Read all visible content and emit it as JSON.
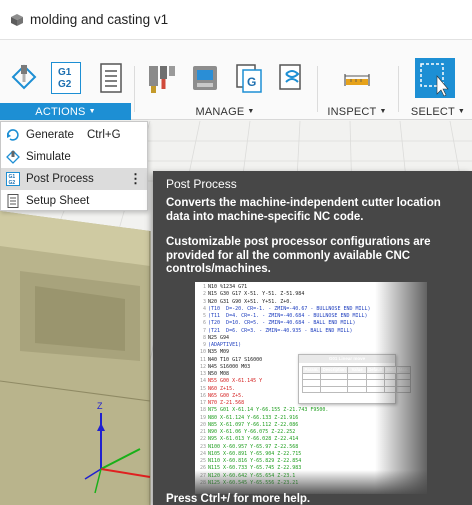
{
  "window": {
    "title": "molding and casting v1",
    "icon": "cube-icon"
  },
  "toolbar": {
    "groups": [
      {
        "label": "ACTIONS",
        "active": true
      },
      {
        "label": "MANAGE"
      },
      {
        "label": "INSPECT"
      },
      {
        "label": "SELECT"
      }
    ],
    "tools": [
      {
        "name": "simulate-tool-icon"
      },
      {
        "name": "post-process-tool",
        "text": "G1\nG2"
      },
      {
        "name": "setup-sheet-tool-icon"
      },
      {
        "name": "tool-library-icon"
      },
      {
        "name": "machine-library-icon"
      },
      {
        "name": "nc-program-icon",
        "text": "G"
      },
      {
        "name": "post-library-icon"
      },
      {
        "name": "measure-icon"
      },
      {
        "name": "window-select-icon"
      }
    ]
  },
  "menu": {
    "items": [
      {
        "label": "Generate",
        "shortcut": "Ctrl+G",
        "icon": "generate-icon"
      },
      {
        "label": "Simulate",
        "icon": "simulate-icon"
      },
      {
        "label": "Post Process",
        "icon": "post-process-icon",
        "more": "⋮",
        "active": true
      },
      {
        "label": "Setup Sheet",
        "icon": "setup-sheet-icon"
      }
    ]
  },
  "tooltip": {
    "title": "Post Process",
    "description": "Converts the machine-independent cutter location data into machine-specific NC code.",
    "detail": "Customizable post processor configurations are provided for all the commonly available CNC controls/machines.",
    "footer": "Press Ctrl+/ for more help.",
    "image": {
      "code_lines": [
        {
          "n": "1",
          "text": "N10 %1234 G71",
          "color": "#222"
        },
        {
          "n": "2",
          "text": "N15 G30 G17 X-51. Y-51. Z-51.984",
          "color": "#222"
        },
        {
          "n": "3",
          "text": "N20 G31 G90 X+51. Y+51. Z+0.",
          "color": "#222"
        },
        {
          "n": "4",
          "text": "(T10  D=-20. CR=-1. - ZMIN=-40.67 - BULLNOSE END MILL)",
          "color": "#1f3fbf"
        },
        {
          "n": "5",
          "text": "(T11  D=4. CR=-1. - ZMIN=-40.684 - BULLNOSE END MILL)",
          "color": "#1f3fbf"
        },
        {
          "n": "6",
          "text": "(T20  D=10. CR=5. - ZMIN=-40.684 - BALL END MILL)",
          "color": "#1f3fbf"
        },
        {
          "n": "7",
          "text": "(T21  D=6. CR=3. - ZMIN=-40.935 - BALL END MILL)",
          "color": "#1f3fbf"
        },
        {
          "n": "8",
          "text": "N25 G94",
          "color": "#222"
        },
        {
          "n": "9",
          "text": "(ADAPTIVE1)",
          "color": "#1f3fbf"
        },
        {
          "n": "10",
          "text": "N35 M09",
          "color": "#222"
        },
        {
          "n": "11",
          "text": "N40 T10 G17 S16000",
          "color": "#222"
        },
        {
          "n": "12",
          "text": "N45 S16000 M03",
          "color": "#222"
        },
        {
          "n": "13",
          "text": "N50 M08",
          "color": "#222"
        },
        {
          "n": "14",
          "text": "N55 G00 X-61.145 Y",
          "color": "#d42020"
        },
        {
          "n": "15",
          "text": "N60 Z+15.",
          "color": "#d42020"
        },
        {
          "n": "16",
          "text": "N65 G00 Z+5.",
          "color": "#d42020"
        },
        {
          "n": "17",
          "text": "N70 Z-21.568",
          "color": "#d42020"
        },
        {
          "n": "18",
          "text": "N75 G01 X-61.14 Y-66.155 Z-21.743 F9500.",
          "color": "#1e9e1e"
        },
        {
          "n": "19",
          "text": "N80 X-61.124 Y-66.133 Z-21.916",
          "color": "#1e9e1e"
        },
        {
          "n": "20",
          "text": "N85 X-61.097 Y-66.112 Z-22.086",
          "color": "#1e9e1e"
        },
        {
          "n": "21",
          "text": "N90 X-61.06 Y-66.075 Z-22.252",
          "color": "#1e9e1e"
        },
        {
          "n": "22",
          "text": "N95 X-61.013 Y-66.028 Z-22.414",
          "color": "#1e9e1e"
        },
        {
          "n": "23",
          "text": "N100 X-60.957 Y-65.97 Z-22.568",
          "color": "#1e9e1e"
        },
        {
          "n": "24",
          "text": "N105 X-60.891 Y-65.904 Z-22.715",
          "color": "#1e9e1e"
        },
        {
          "n": "25",
          "text": "N110 X-60.816 Y-65.829 Z-22.854",
          "color": "#1e9e1e"
        },
        {
          "n": "26",
          "text": "N115 X-60.733 Y-65.745 Z-22.983",
          "color": "#1e9e1e"
        },
        {
          "n": "27",
          "text": "N120 X-60.642 Y-65.654 Z-23.1",
          "color": "#1e9e1e"
        },
        {
          "n": "28",
          "text": "N125 X-60.545 Y-65.556 Z-23.21",
          "color": "#1e9e1e"
        }
      ],
      "dialog": {
        "title": "G01 Linear move",
        "headers": [
          "Param.",
          "Description",
          "Value",
          "Default",
          "Min.",
          "Max."
        ],
        "rows": [
          [
            "X",
            "X coordinate",
            "-61.14",
            "",
            "",
            ""
          ],
          [
            "Y",
            "Y coordinate",
            "-66.155",
            "",
            "",
            ""
          ],
          [
            "Z",
            "Z coordinate",
            "-21.743",
            "",
            "",
            ""
          ]
        ]
      }
    }
  },
  "viewcube": {
    "axis_label": "Z"
  },
  "colors": {
    "accent": "#1d8fd4",
    "tooltip_bg": "#474747",
    "select_blue": "#1d8fd4"
  }
}
